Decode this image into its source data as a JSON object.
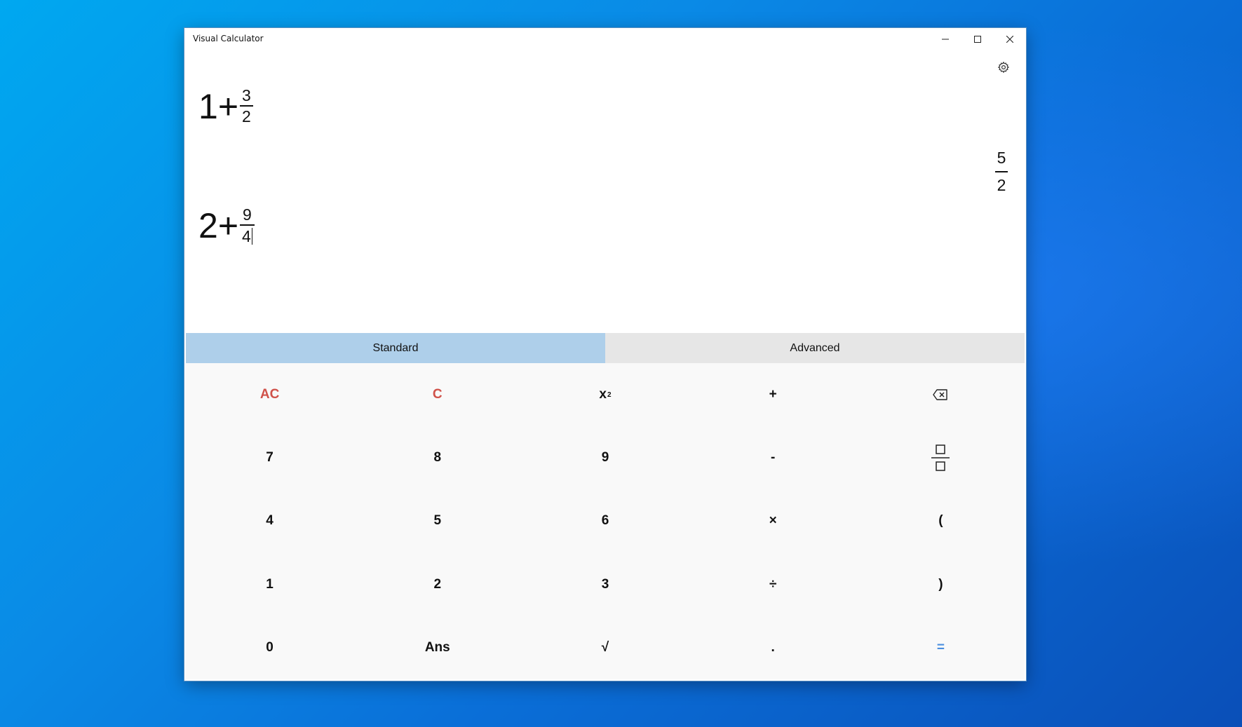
{
  "window": {
    "title": "Visual Calculator"
  },
  "icons": {
    "minimize": "minimize-icon",
    "maximize": "maximize-icon",
    "close": "close-icon",
    "settings": "gear-icon",
    "backspace": "backspace-icon",
    "fraction": "fraction-icon"
  },
  "history": [
    {
      "whole": "1",
      "op": "+",
      "numerator": "3",
      "denominator": "2",
      "result_numerator": "5",
      "result_denominator": "2"
    }
  ],
  "current": {
    "whole": "2",
    "op": "+",
    "numerator": "9",
    "denominator": "4"
  },
  "tabs": {
    "standard": "Standard",
    "advanced": "Advanced",
    "active": "Standard"
  },
  "keys": {
    "ac": "AC",
    "c": "C",
    "square_base": "x",
    "square_exp": "2",
    "plus": "+",
    "seven": "7",
    "eight": "8",
    "nine": "9",
    "minus": "-",
    "four": "4",
    "five": "5",
    "six": "6",
    "times": "×",
    "lparen": "(",
    "one": "1",
    "two": "2",
    "three": "3",
    "divide": "÷",
    "rparen": ")",
    "zero": "0",
    "ans": "Ans",
    "sqrt": "√",
    "dot": ".",
    "equals": "="
  },
  "colors": {
    "active_tab": "#aecfea",
    "inactive_tab": "#e6e6e6",
    "clear_keys": "#d0524a",
    "equals_key": "#4b8fe0"
  }
}
